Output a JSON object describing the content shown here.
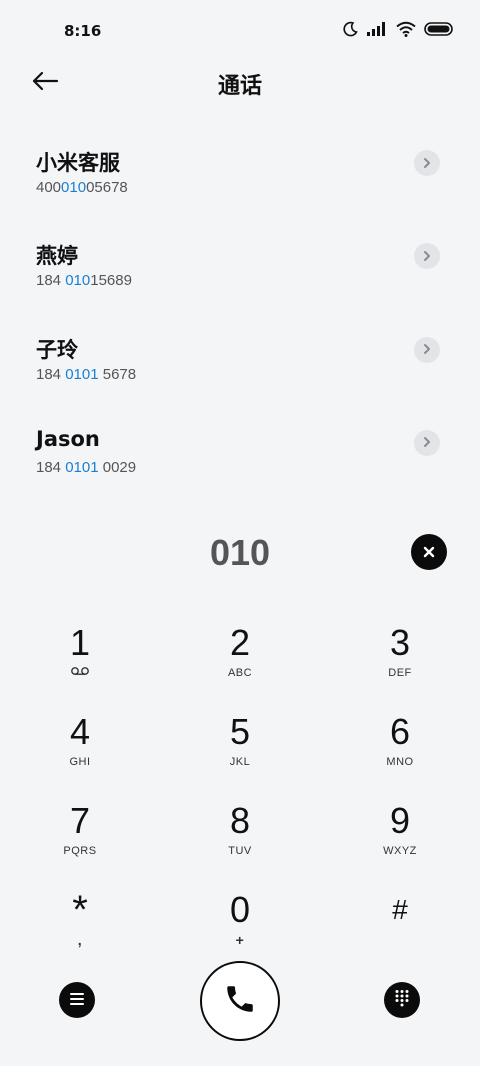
{
  "status_bar": {
    "time": "8:16",
    "icons": [
      "moon-icon",
      "signal-icon",
      "wifi-icon",
      "battery-icon"
    ]
  },
  "header": {
    "title": "通话",
    "back_icon": "arrow-left-icon"
  },
  "results": [
    {
      "name": "小米客服",
      "number_parts": [
        "400",
        "010",
        "05678"
      ]
    },
    {
      "name": "燕婷",
      "number_parts": [
        "184 ",
        "010",
        "15689"
      ]
    },
    {
      "name": "子玲",
      "number_parts": [
        "184 ",
        "0101",
        " 5678"
      ]
    },
    {
      "name": "Jason",
      "number_parts": [
        "184 ",
        "0101",
        " 0029"
      ]
    }
  ],
  "entry": {
    "digits": "010",
    "clear_icon": "close-icon"
  },
  "keypad": [
    {
      "digit": "1",
      "letters": "",
      "icon": "voicemail-icon"
    },
    {
      "digit": "2",
      "letters": "ABC"
    },
    {
      "digit": "3",
      "letters": "DEF"
    },
    {
      "digit": "4",
      "letters": "GHI"
    },
    {
      "digit": "5",
      "letters": "JKL"
    },
    {
      "digit": "6",
      "letters": "MNO"
    },
    {
      "digit": "7",
      "letters": "PQRS"
    },
    {
      "digit": "8",
      "letters": "TUV"
    },
    {
      "digit": "9",
      "letters": "WXYZ"
    },
    {
      "digit": "*",
      "letters": ","
    },
    {
      "digit": "0",
      "letters": "+"
    },
    {
      "digit": "#",
      "letters": ""
    }
  ],
  "bottom_bar": {
    "menu_icon": "menu-icon",
    "call_icon": "phone-icon",
    "dialpad_icon": "dialpad-icon"
  },
  "colors": {
    "background": "#f4f5f7",
    "highlight": "#1a7fd4",
    "dark": "#0b0b0b"
  }
}
